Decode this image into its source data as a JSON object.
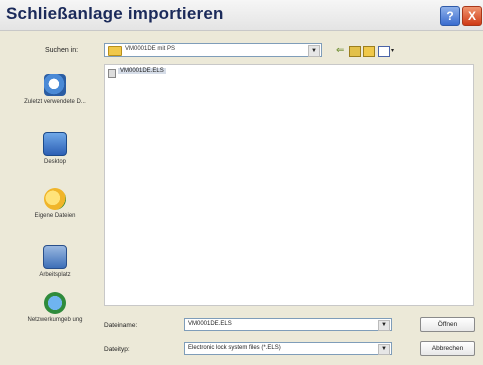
{
  "window": {
    "title": "Schließanlage importieren",
    "help_label": "?",
    "close_label": "X"
  },
  "toolbar": {
    "look_in_label": "Suchen in:",
    "look_in_value": "VM0001DE mit PS",
    "dropdown_glyph": "▼",
    "views_glyph": "▾"
  },
  "places": [
    {
      "label": "Zuletzt verwendete D...",
      "icon": "recent-documents-icon"
    },
    {
      "label": "Desktop",
      "icon": "desktop-icon"
    },
    {
      "label": "Eigene Dateien",
      "icon": "my-documents-icon"
    },
    {
      "label": "Arbeitsplatz",
      "icon": "my-computer-icon"
    },
    {
      "label": "Netzwerkumgeb ung",
      "icon": "network-icon"
    }
  ],
  "files": [
    {
      "name": "VM0001DE.ELS"
    }
  ],
  "filename": {
    "label": "Dateiname:",
    "value": "VM0001DE.ELS",
    "dropdown_glyph": "▼"
  },
  "filetype": {
    "label": "Dateityp:",
    "value": "Electronic lock system files (*.ELS)",
    "dropdown_glyph": "▼"
  },
  "buttons": {
    "open": "Öffnen",
    "cancel": "Abbrechen"
  },
  "colors": {
    "title_text": "#1b2a5a",
    "selection": "#d6dde8",
    "input_border": "#7f9db9"
  }
}
